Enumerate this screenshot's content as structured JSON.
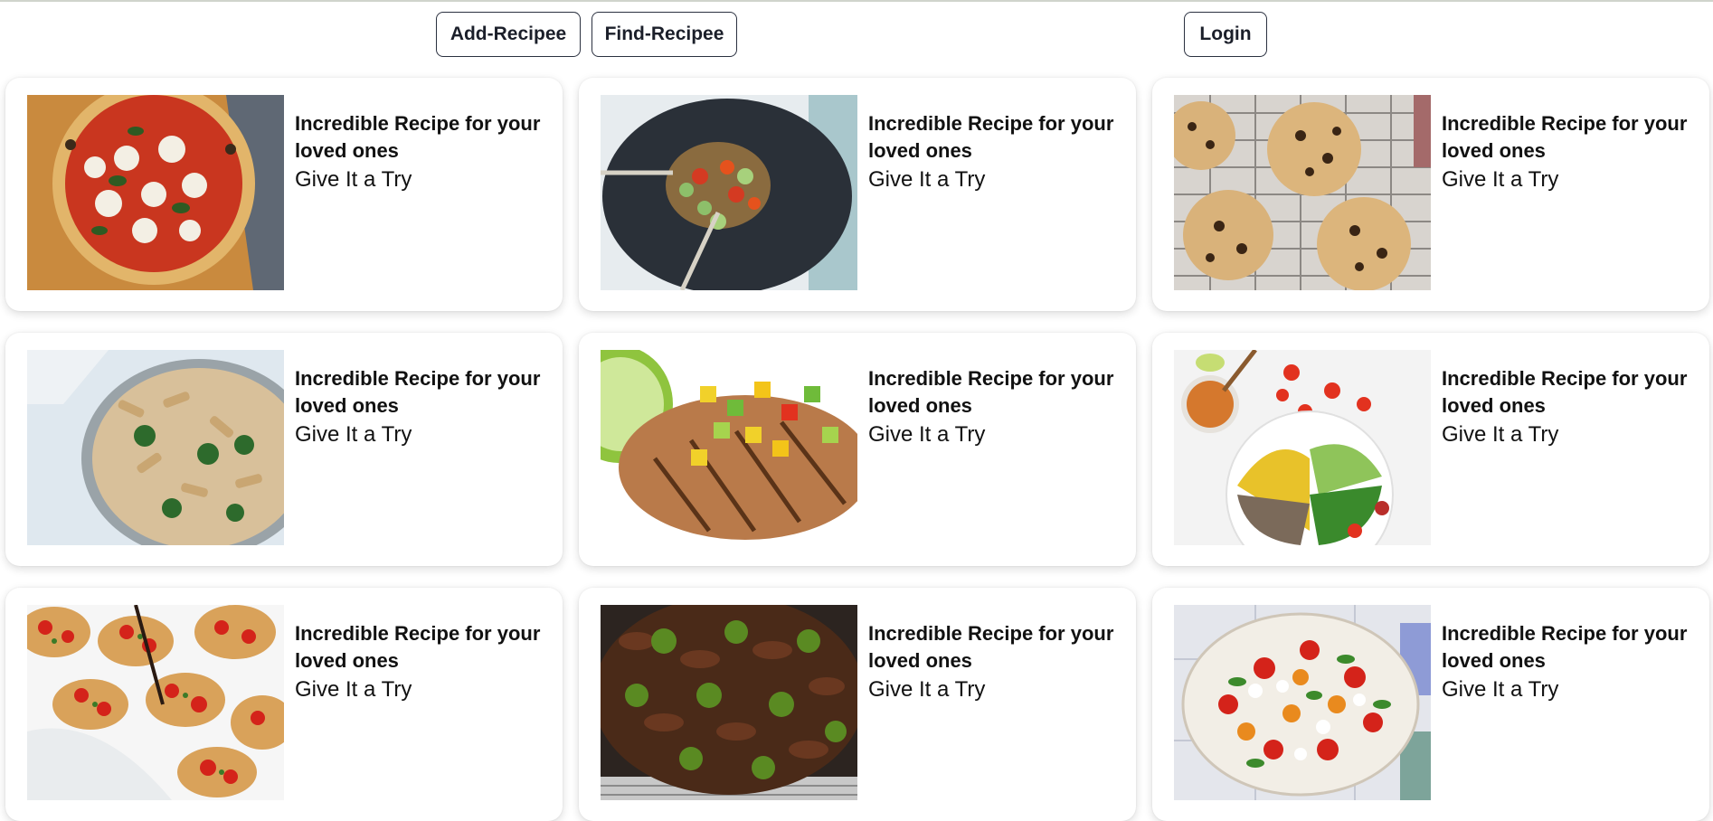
{
  "nav": {
    "add_label": "Add-Recipee",
    "find_label": "Find-Recipee",
    "login_label": "Login"
  },
  "cards": [
    {
      "title": "Incredible Recipe for your loved ones",
      "subtitle": "Give It a Try",
      "image": "pizza-margherita"
    },
    {
      "title": "Incredible Recipe for your loved ones",
      "subtitle": "Give It a Try",
      "image": "veggie-stir-fry"
    },
    {
      "title": "Incredible Recipe for your loved ones",
      "subtitle": "Give It a Try",
      "image": "chocolate-chip-cookies"
    },
    {
      "title": "Incredible Recipe for your loved ones",
      "subtitle": "Give It a Try",
      "image": "broccoli-penne"
    },
    {
      "title": "Incredible Recipe for your loved ones",
      "subtitle": "Give It a Try",
      "image": "grilled-chicken-salsa"
    },
    {
      "title": "Incredible Recipe for your loved ones",
      "subtitle": "Give It a Try",
      "image": "salad-bowl"
    },
    {
      "title": "Incredible Recipe for your loved ones",
      "subtitle": "Give It a Try",
      "image": "bruschetta"
    },
    {
      "title": "Incredible Recipe for your loved ones",
      "subtitle": "Give It a Try",
      "image": "beef-broccoli"
    },
    {
      "title": "Incredible Recipe for your loved ones",
      "subtitle": "Give It a Try",
      "image": "caprese-salad"
    }
  ]
}
